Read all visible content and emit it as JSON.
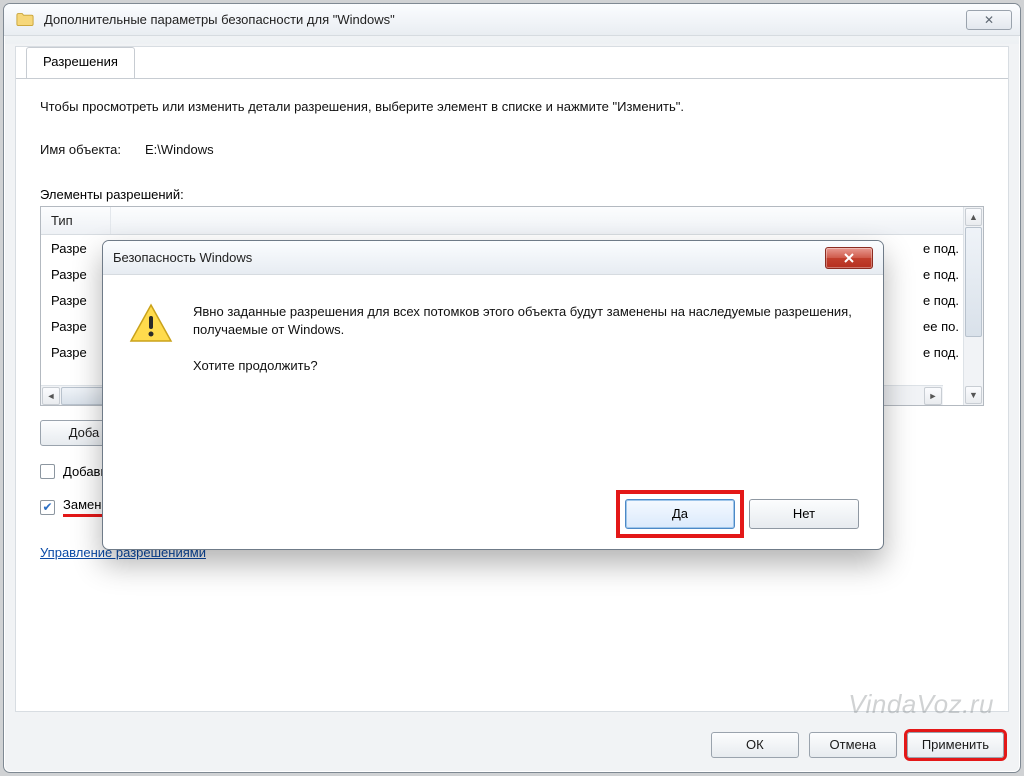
{
  "mainWindow": {
    "title": "Дополнительные параметры безопасности  для \"Windows\"",
    "closeGlyph": "✕"
  },
  "tabs": {
    "permissions": "Разрешения"
  },
  "intro": "Чтобы просмотреть или изменить детали разрешения, выберите элемент в списке и нажмите \"Изменить\".",
  "object": {
    "label": "Имя объекта:",
    "path": "E:\\Windows"
  },
  "permListLabel": "Элементы разрешений:",
  "table": {
    "header": {
      "type": "Тип"
    },
    "rows": [
      {
        "type": "Разре",
        "suffix": "е под."
      },
      {
        "type": "Разре",
        "suffix": "е под."
      },
      {
        "type": "Разре",
        "suffix": "е под."
      },
      {
        "type": "Разре",
        "suffix": "ее по."
      },
      {
        "type": "Разре",
        "suffix": "е под."
      }
    ]
  },
  "buttons": {
    "add": "Доба"
  },
  "checks": {
    "inheritParent": "Добавить разрешения, наследуемые от родительских объектов",
    "replaceChild": "Заменить все разрешения дочернего объекта на разрешения, наследуемые от этого объекта"
  },
  "link": "Управление разрешениями",
  "footer": {
    "ok": "ОК",
    "cancel": "Отмена",
    "apply": "Применить"
  },
  "modal": {
    "title": "Безопасность Windows",
    "line1": "Явно заданные разрешения для всех потомков этого объекта будут заменены на наследуемые разрешения, получаемые от Windows.",
    "line2": "Хотите продолжить?",
    "yes": "Да",
    "no": "Нет"
  },
  "watermark": "VindaVoz.ru"
}
